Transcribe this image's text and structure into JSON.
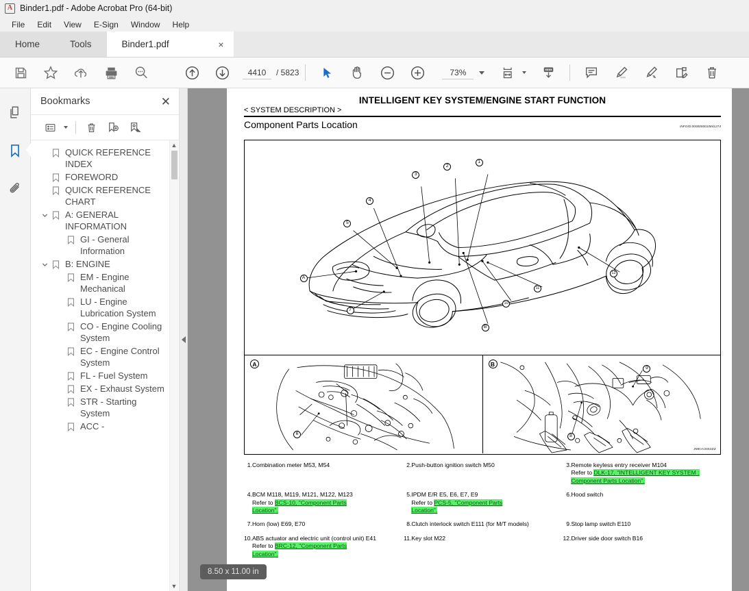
{
  "window": {
    "title": "Binder1.pdf - Adobe Acrobat Pro (64-bit)",
    "logo": "acrobat-logo"
  },
  "menubar": {
    "items": [
      "File",
      "Edit",
      "View",
      "E-Sign",
      "Window",
      "Help"
    ]
  },
  "tabbar": {
    "home": "Home",
    "tools": "Tools",
    "document_tab": "Binder1.pdf",
    "close": "×"
  },
  "toolbar": {
    "icons_left": [
      "save-icon",
      "star-icon",
      "upload-cloud-icon",
      "print-icon",
      "search-icon"
    ],
    "prev_page": "up-arrow-circle-icon",
    "next_page": "down-arrow-circle-icon",
    "page_current": "4410",
    "page_total": "/ 5823",
    "select_tool": "cursor-arrow-icon",
    "hand_tool": "hand-icon",
    "zoom_out": "minus-circle-icon",
    "zoom_in": "plus-circle-icon",
    "zoom_value": "73%",
    "fit_width": "fit-page-icon",
    "scroll_mode": "page-display-icon",
    "icons_right": [
      "comment-icon",
      "highlight-icon",
      "sign-icon",
      "stamp-icon",
      "delete-icon"
    ]
  },
  "rail": {
    "items": [
      {
        "name": "page-thumbnails-icon",
        "active": false
      },
      {
        "name": "bookmarks-icon",
        "active": true
      },
      {
        "name": "attachments-icon",
        "active": false
      }
    ]
  },
  "bookmarks_panel": {
    "title": "Bookmarks",
    "close": "✕",
    "toolbar": [
      "options-list-icon",
      "delete-bookmark-icon",
      "new-bookmark-icon",
      "find-bookmark-icon"
    ],
    "items": [
      {
        "label": "QUICK REFERENCE INDEX",
        "level": 0,
        "expandable": false
      },
      {
        "label": "FOREWORD",
        "level": 0,
        "expandable": false
      },
      {
        "label": "QUICK REFERENCE CHART",
        "level": 0,
        "expandable": false
      },
      {
        "label": "A: GENERAL INFORMATION",
        "level": 0,
        "expandable": true,
        "expanded": true
      },
      {
        "label": "GI - General Information",
        "level": 1,
        "expandable": false
      },
      {
        "label": "B: ENGINE",
        "level": 0,
        "expandable": true,
        "expanded": true
      },
      {
        "label": "EM - Engine Mechanical",
        "level": 1,
        "expandable": false
      },
      {
        "label": "LU - Engine Lubrication System",
        "level": 1,
        "expandable": false
      },
      {
        "label": "CO - Engine Cooling System",
        "level": 1,
        "expandable": false
      },
      {
        "label": "EC - Engine Control System",
        "level": 1,
        "expandable": false
      },
      {
        "label": "FL - Fuel System",
        "level": 1,
        "expandable": false
      },
      {
        "label": "EX - Exhaust System",
        "level": 1,
        "expandable": false
      },
      {
        "label": "STR - Starting System",
        "level": 1,
        "expandable": false
      },
      {
        "label": "ACC -",
        "level": 1,
        "expandable": false
      }
    ]
  },
  "viewer": {
    "page_size_badge": "8.50 x 11.00 in",
    "collapse_handle": "left-arrow-icon"
  },
  "document": {
    "heading": "INTELLIGENT KEY SYSTEM/ENGINE START FUNCTION",
    "subheading": "< SYSTEM DESCRIPTION >",
    "section_title": "Component Parts Location",
    "infoid": "INFOID:0000000010841274",
    "figure_code": "JMKIA3453ZZ",
    "figure_tags": [
      "A",
      "B"
    ],
    "callouts_main": [
      "1",
      "2",
      "3",
      "4",
      "5",
      "7",
      "10",
      "11",
      "12",
      "A",
      "B"
    ],
    "callouts_detail_a": [
      "6"
    ],
    "callouts_detail_b": [
      "8",
      "9"
    ],
    "captions": [
      {
        "num": "1.",
        "text": "Combination meter M53, M54",
        "links": []
      },
      {
        "num": "2.",
        "text": "Push-button ignition switch M50",
        "links": []
      },
      {
        "num": "3.",
        "text": "Remote keyless entry receiver M104",
        "refer": "Refer to ",
        "links": [
          "DLK-17, \"INTELLIGENT KEY SYSTEM :",
          "Component  Parts  Location\"."
        ]
      },
      {
        "num": "4.",
        "text": "BCM M118, M119, M121, M122, M123",
        "refer": "Refer to ",
        "links": [
          "BCS-10, \"Component Parts",
          "Location\"."
        ]
      },
      {
        "num": "5.",
        "text": "IPDM E/R E5, E6, E7, E9",
        "refer": "Refer to ",
        "links": [
          "PCS-5, \"Component Parts",
          "Location\"."
        ]
      },
      {
        "num": "6.",
        "text": "Hood switch",
        "links": []
      },
      {
        "num": "7.",
        "text": "Horn (low) E69, E70",
        "links": []
      },
      {
        "num": "8.",
        "text": "Clutch interlock switch E111 (for M/T models)",
        "links": []
      },
      {
        "num": "9.",
        "text": "Stop lamp switch E110",
        "links": []
      },
      {
        "num": "10.",
        "text": "ABS actuator and electric unit (control unit) E41",
        "refer": "Refer to ",
        "links": [
          "BRC-12, \"Component Parts",
          "Location\"."
        ]
      },
      {
        "num": "11.",
        "text": "Key slot M22",
        "links": []
      },
      {
        "num": "12.",
        "text": "Driver side door switch B16",
        "links": []
      }
    ]
  },
  "colors": {
    "link_highlight": "#5bf06a",
    "link_text": "#0a5d13",
    "accent_blue": "#1b6ec2",
    "viewer_bg": "#929292"
  }
}
